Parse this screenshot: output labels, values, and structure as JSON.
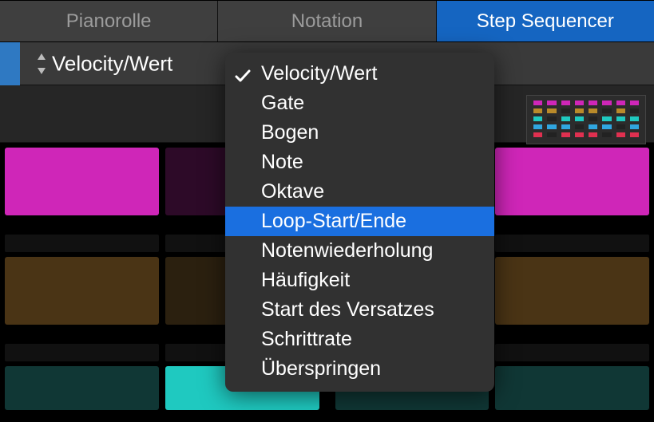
{
  "tabs": {
    "pianoroll": "Pianorolle",
    "notation": "Notation",
    "stepseq": "Step Sequencer"
  },
  "active_tab": "stepseq",
  "param_label": "Velocity/Wert",
  "popup": {
    "items": [
      "Velocity/Wert",
      "Gate",
      "Bogen",
      "Note",
      "Oktave",
      "Loop-Start/Ende",
      "Notenwiederholung",
      "Häufigkeit",
      "Start des Versatzes",
      "Schrittrate",
      "Überspringen"
    ],
    "selected_index": 0,
    "highlighted_index": 5
  },
  "colors": {
    "accent_blue": "#1a6fe0",
    "tab_active": "#1565c1",
    "magenta": "#cf26b8",
    "teal": "#1fc9c0",
    "olive": "#4a3415",
    "panel": "#313131"
  },
  "thumb_colors": {
    "r0": "#cf26b8",
    "r1": "#b98a2a",
    "r2": "#1fc9c0",
    "r3": "#30a6e0",
    "r4": "#e03050"
  }
}
